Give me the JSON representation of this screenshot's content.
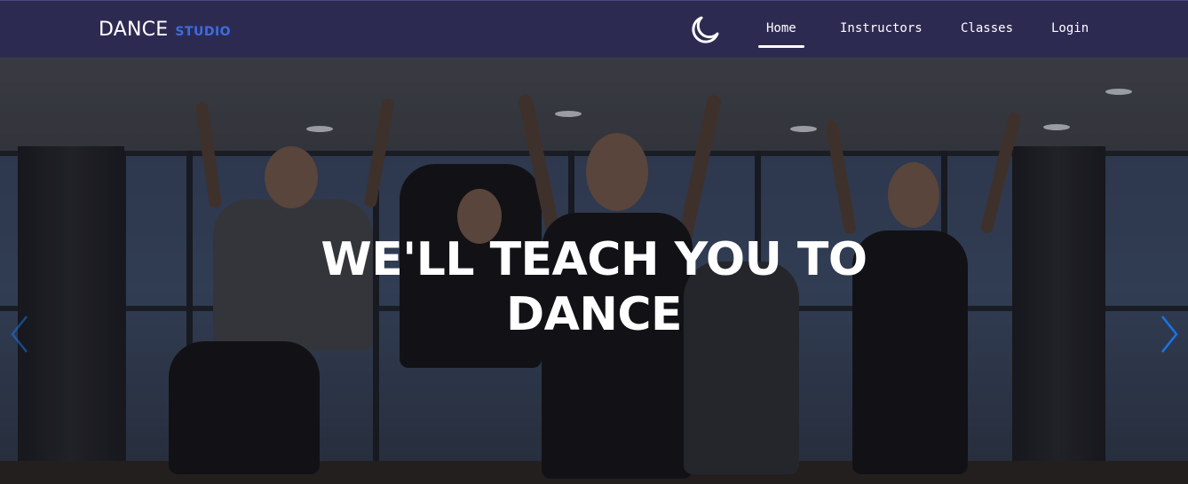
{
  "brand": {
    "name": "DANCE",
    "accent": "STUDIO"
  },
  "theme_toggle": {
    "icon": "moon-icon"
  },
  "nav": {
    "items": [
      {
        "label": "Home",
        "active": true
      },
      {
        "label": "Instructors",
        "active": false
      },
      {
        "label": "Classes",
        "active": false
      },
      {
        "label": "Login",
        "active": false
      }
    ]
  },
  "hero": {
    "headline_line1": "WE'LL TEACH YOU TO",
    "headline_line2": "DANCE",
    "prev_icon": "chevron-left-icon",
    "next_icon": "chevron-right-icon"
  },
  "colors": {
    "navbar_bg": "#2d2a52",
    "brand_accent": "#3a6de0",
    "carousel_arrow": "#1a73e8",
    "text": "#ffffff"
  }
}
